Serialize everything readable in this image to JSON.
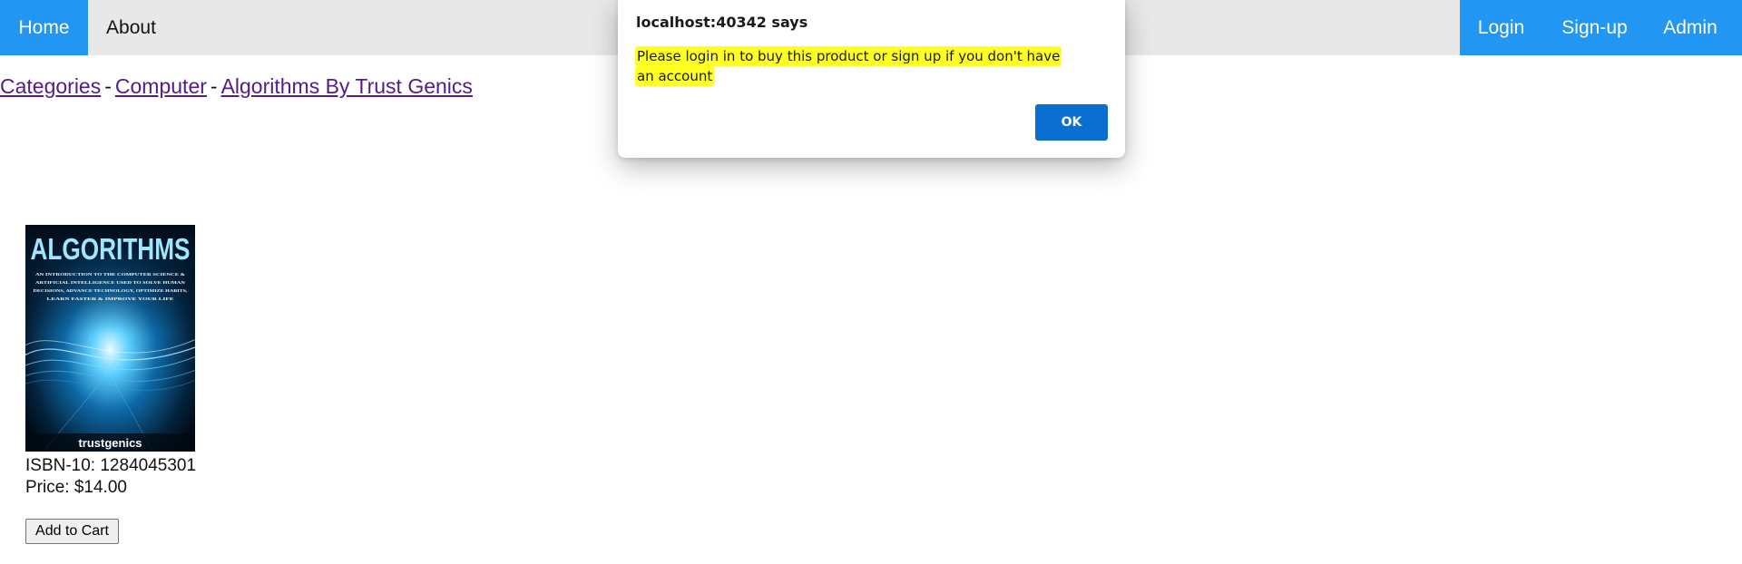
{
  "nav": {
    "home": "Home",
    "about": "About",
    "login": "Login",
    "signup": "Sign-up",
    "admin": "Admin"
  },
  "breadcrumb": {
    "items": [
      "Categories",
      "Computer",
      "Algorithms By Trust Genics"
    ],
    "separator": "-"
  },
  "product": {
    "cover": {
      "title": "ALGORITHMS",
      "subtitle_lines": [
        "AN INTRODUCTION TO THE COMPUTER SCIENCE &",
        "ARTIFICIAL INTELLIGENCE USED TO SOLVE HUMAN",
        "DECISIONS, ADVANCE TECHNOLOGY, OPTIMIZE HABITS,",
        "LEARN FASTER & IMPROVE YOUR LIFE"
      ],
      "publisher": "trustgenics"
    },
    "isbn": "ISBN-10: 1284045301",
    "price": "Price: $14.00",
    "add_to_cart": "Add to Cart"
  },
  "dialog": {
    "title": "localhost:40342 says",
    "message": "Please login in to buy this product or sign up if you don't have an account",
    "ok": "OK"
  },
  "colors": {
    "nav_active": "#2196f3",
    "nav_bg": "#e8e8e8",
    "link_visited": "#551a8b",
    "highlight": "#ffff22",
    "dialog_button": "#0a6fd1"
  }
}
